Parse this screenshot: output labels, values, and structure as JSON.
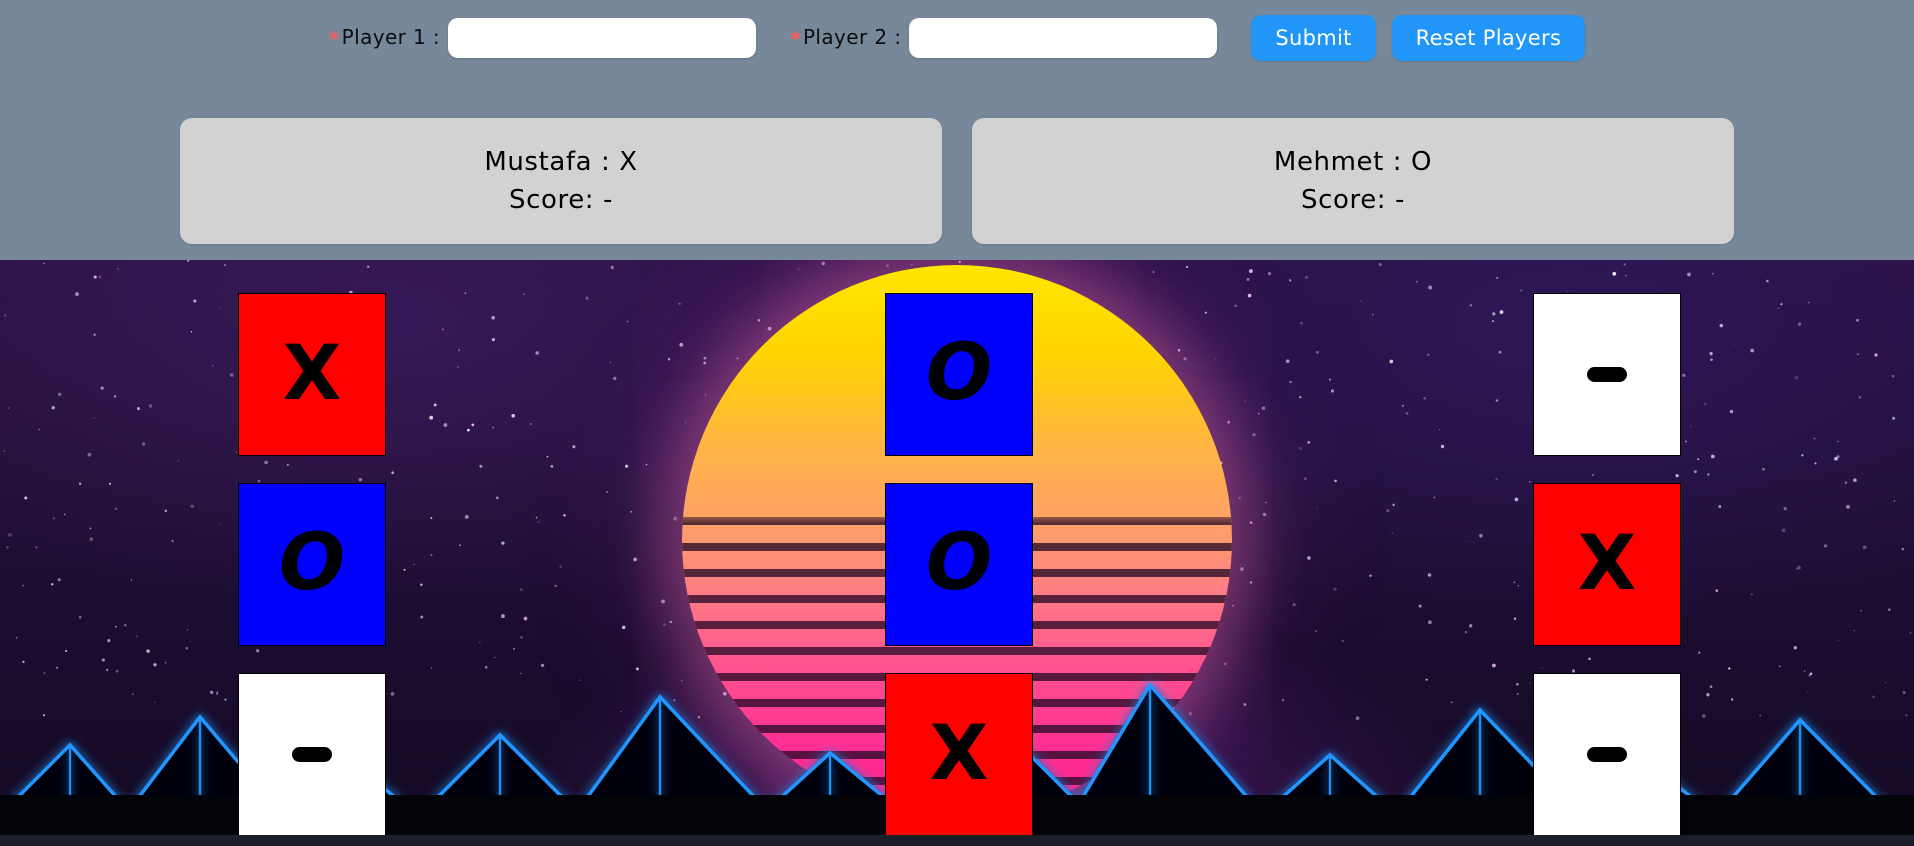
{
  "form": {
    "player1": {
      "required_marker": "*",
      "label": "Player 1 :",
      "value": "",
      "placeholder": ""
    },
    "player2": {
      "required_marker": "*",
      "label": "Player 2 :",
      "value": "",
      "placeholder": ""
    },
    "submit_label": "Submit",
    "reset_label": "Reset Players",
    "accent_color": "#2196f8",
    "required_color": "#ff5a5a"
  },
  "scoreboard": {
    "player_one": {
      "name_line": "Mustafa : X",
      "score_line": "Score: -"
    },
    "player_two": {
      "name_line": "Mehmet : O",
      "score_line": "Score: -"
    },
    "panel_color": "#d2d2d2"
  },
  "board": {
    "colors": {
      "x_cell": "#ff0000",
      "o_cell": "#0000ff",
      "empty_cell": "#ffffff",
      "mark": "#000000"
    },
    "cells": [
      {
        "id": "cell-0-0",
        "mark": "X",
        "state": "x"
      },
      {
        "id": "cell-0-1",
        "mark": "O",
        "state": "o"
      },
      {
        "id": "cell-0-2",
        "mark": "-",
        "state": "empty"
      },
      {
        "id": "cell-1-0",
        "mark": "O",
        "state": "o"
      },
      {
        "id": "cell-1-1",
        "mark": "O",
        "state": "o"
      },
      {
        "id": "cell-1-2",
        "mark": "X",
        "state": "x"
      },
      {
        "id": "cell-2-0",
        "mark": "-",
        "state": "empty"
      },
      {
        "id": "cell-2-1",
        "mark": "X",
        "state": "x"
      },
      {
        "id": "cell-2-2",
        "mark": "-",
        "state": "empty"
      }
    ]
  },
  "background": {
    "header_color": "#78889b",
    "sky_top": "#2a1040",
    "sun_top": "#ffe600",
    "sun_bottom": "#ff1f8d",
    "wireframe": "#1e90ff"
  }
}
